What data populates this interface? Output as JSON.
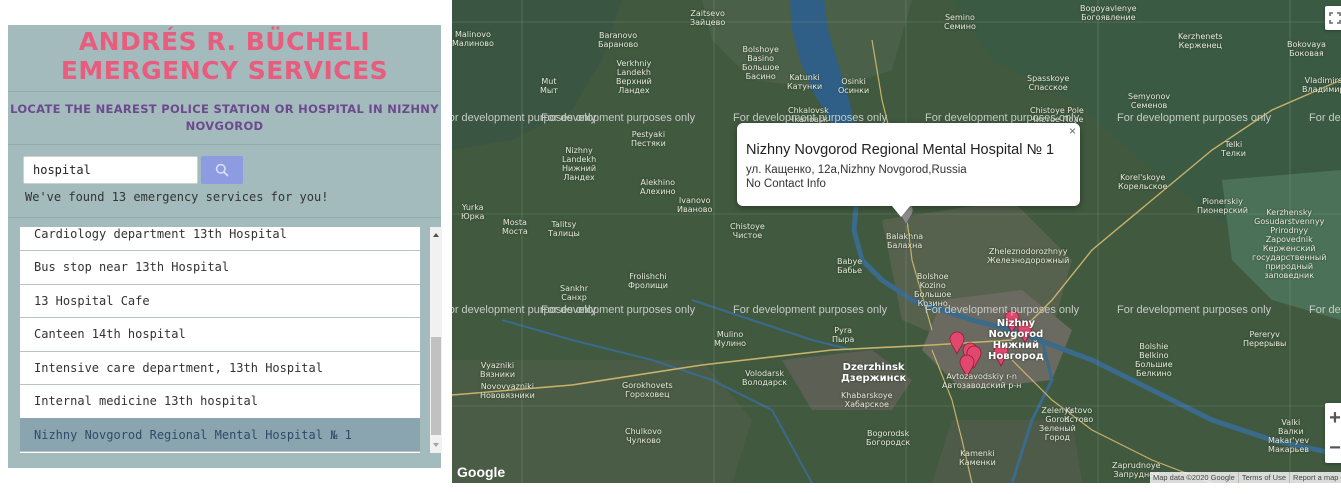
{
  "sidebar": {
    "title_line1": "ANDRÉS R. BÜCHELI",
    "title_line2": "EMERGENCY SERVICES",
    "subtitle_line1": "LOCATE THE NEAREST POLICE STATION OR HOSPITAL IN NIZHNY",
    "subtitle_line2": "NOVGOROD",
    "search": {
      "value": "hospital",
      "button_icon": "search-icon"
    },
    "result_count": "We've found 13 emergency services for you!",
    "results": [
      {
        "label": "Cardiology department 13th Hospital",
        "selected": false
      },
      {
        "label": "Bus stop near 13th Hospital",
        "selected": false
      },
      {
        "label": "13 Hospital Cafe",
        "selected": false
      },
      {
        "label": "Canteen 14th hospital",
        "selected": false
      },
      {
        "label": "Intensive care department, 13th Hospital",
        "selected": false
      },
      {
        "label": "Internal medicine 13th hospital",
        "selected": false
      },
      {
        "label": "Nizhny Novgorod Regional Mental Hospital № 1",
        "selected": true
      }
    ]
  },
  "map": {
    "watermark": "For development purposes only",
    "info_window": {
      "title": "Nizhny Novgorod Regional Mental Hospital № 1",
      "address": "ул. Кащенко, 12а,Nizhny Novgorod,Russia",
      "contact": "No Contact Info",
      "close": "×"
    },
    "places": [
      "Malinovo\nМалиново",
      "Baranovo\nБараново",
      "Zaitsevo\nЗайцево",
      "Bolshoye\nBasino\nБольшое\nБасино",
      "Mut\nМыт",
      "Verkhniy\nLandekh\nВерхний\nЛандех",
      "Katunki\nКатунки",
      "Osinki\nОсинки",
      "Semino\nСемино",
      "Bogoyavlenye\nБогоявление",
      "Kerzhenets\nКерженец",
      "Bokovaya\nБоковая",
      "Spasskoye\nСпасское",
      "Semyonov\nСеменов",
      "Vladimirskoye\nВладимирское",
      "Chkalovsk\nЧкаловск",
      "Pestyaki\nПестяки",
      "Chistoye Pole\nЧистое Поле",
      "Nizhny\nLandekh\nНижний\nЛандех",
      "Alekhino\nАлехино",
      "Ivanovo\nИваново",
      "Telki\nТелки",
      "Korel'skoye\nКорельское",
      "Pionerskiy\nПионерский",
      "Yurka\nЮрка",
      "Mosta\nМоста",
      "Talitsy\nТалицы",
      "Chistoye\nЧистое",
      "Balakhna\nБалахна",
      "Babye\nБабье",
      "Zheleznodorozhnyy\nЖелезнодорожный",
      "Kerzhensky\nGosudarstvennyy\nPrirodnyy\nZapovednik\nКерженский\nгосударственный\nприродный\nзаповедник",
      "Sankhr\nСанхр",
      "Frolishchi\nФролищи",
      "Bolshoe\nKozino\nБольшое\nКозино",
      "Mulino\nМулино",
      "Pyra\nПыра",
      "Dzerzhinsk\nДзержинск",
      "Vyazniki\nВязники",
      "Novovyazniki\nНововязники",
      "Gorokhovets\nГороховец",
      "Volodarsk\nВолодарск",
      "Khabarskoye\nХабарское",
      "Bolshie\nBelkino\nБольшие\nБелкино",
      "Pereryv\nПерерывы",
      "Zelenyy\nGorod\nЗеленый\nГород",
      "Kstovo\nКстово",
      "Chulkovo\nЧулково",
      "Bogorodsk\nБогородск",
      "Kamenki\nКаменки",
      "Zaprudnoye\nЗапрудное",
      "Valki\nВалки",
      "Makar'yev\nМакарьев",
      "Nizhny\nNovgorod\nНижний\nНовгород",
      "Avtozavodskiy r-n\nАвтозаводский р-н"
    ],
    "google_logo": "Google",
    "footer": {
      "map_data": "Map data ©2020 Google",
      "terms": "Terms of Use",
      "report": "Report a map error"
    },
    "controls": {
      "zoom_in": "+",
      "zoom_out": "−",
      "fullscreen_icon": "fullscreen-icon"
    }
  }
}
